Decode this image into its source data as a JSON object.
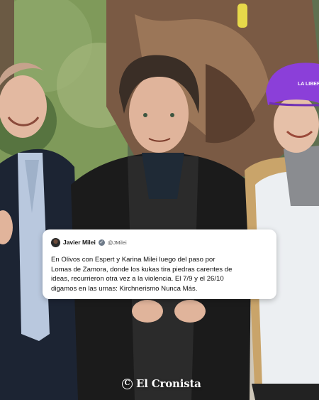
{
  "tweet": {
    "author": "Javier Milei",
    "handle": "@JMilei",
    "verified_icon": "verified-badge-icon",
    "text": "En Olivos con Espert y Karina Milei luego del paso por\nLomas de Zamora, donde los kukas tira piedras carentes de\nideas, recurrieron otra vez a la violencia. El 7/9 y el 26/10\ndigamos en las urnas: Kirchnerismo Nunca Más."
  },
  "cap": {
    "text": "LA LIBERTAD",
    "color": "#8b3fd9"
  },
  "brand": {
    "mark": "C",
    "name": "El Cronista"
  },
  "colors": {
    "card": "#ffffff",
    "cap_purple": "#8b3fd9",
    "jacket_left": "#1c2433",
    "jacket_center": "#1b1b1b",
    "jacket_right": "#eceff2"
  }
}
